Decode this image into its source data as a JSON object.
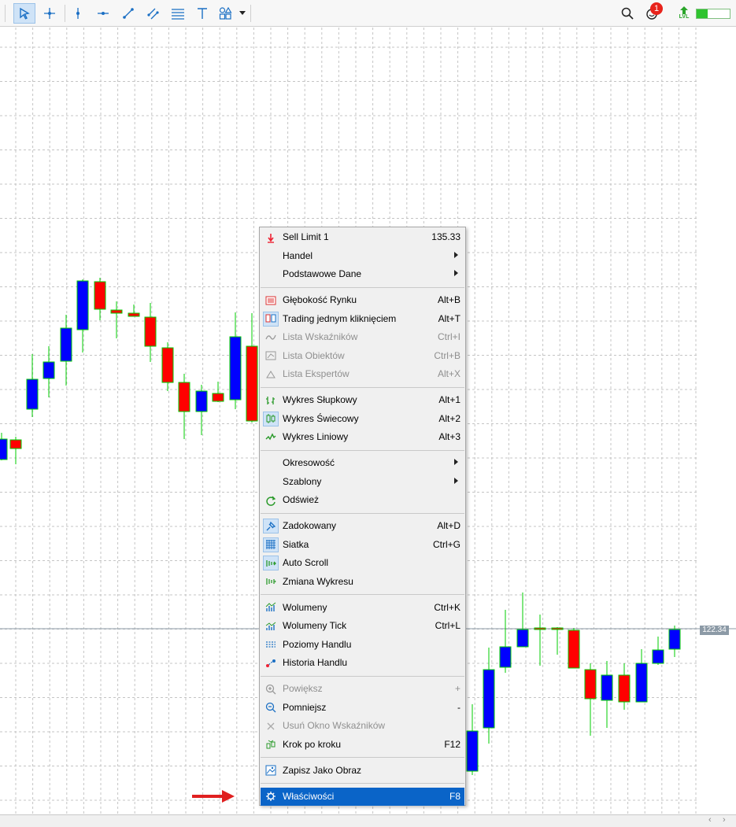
{
  "toolbar": {
    "tools": [
      "cursor-icon",
      "crosshair-icon",
      "vertical-line-icon",
      "horizontal-line-icon",
      "trendline-icon",
      "equidistant-channel-icon",
      "fibonacci-icon",
      "text-icon",
      "shapes-icon",
      "dropdown-arrow-icon"
    ],
    "right_icons": [
      "search-icon",
      "notifications-icon",
      "signal-lvl-icon",
      "battery-icon"
    ],
    "notification_count": "1",
    "lvl_label": "LVL"
  },
  "chart": {
    "current_price_label": "122.34",
    "bull_color": "#0000ff",
    "bear_color": "#ff0000",
    "wick_color": "#00cc00"
  },
  "context_menu": {
    "items": [
      {
        "label": "Sell Limit 1",
        "shortcut": "135.33",
        "icon": "sell-limit-icon"
      },
      {
        "label": "Handel",
        "submenu": true
      },
      {
        "label": "Podstawowe Dane",
        "submenu": true
      },
      {
        "label": "Głębokość Rynku",
        "shortcut": "Alt+B",
        "icon": "depth-of-market-icon"
      },
      {
        "label": "Trading jednym kliknięciem",
        "shortcut": "Alt+T",
        "icon": "one-click-trading-icon",
        "checked": true
      },
      {
        "label": "Lista Wskaźników",
        "shortcut": "Ctrl+I",
        "icon": "indicators-list-icon",
        "disabled": true
      },
      {
        "label": "Lista Obiektów",
        "shortcut": "Ctrl+B",
        "icon": "objects-list-icon",
        "disabled": true
      },
      {
        "label": "Lista Ekspertów",
        "shortcut": "Alt+X",
        "icon": "experts-list-icon",
        "disabled": true
      },
      {
        "label": "Wykres Słupkowy",
        "shortcut": "Alt+1",
        "icon": "bar-chart-icon"
      },
      {
        "label": "Wykres Świecowy",
        "shortcut": "Alt+2",
        "icon": "candlestick-chart-icon",
        "checked": true
      },
      {
        "label": "Wykres Liniowy",
        "shortcut": "Alt+3",
        "icon": "line-chart-icon"
      },
      {
        "label": "Okresowość",
        "submenu": true
      },
      {
        "label": "Szablony",
        "submenu": true
      },
      {
        "label": "Odśwież",
        "icon": "refresh-icon"
      },
      {
        "label": "Zadokowany",
        "shortcut": "Alt+D",
        "icon": "pin-icon",
        "checked": true
      },
      {
        "label": "Siatka",
        "shortcut": "Ctrl+G",
        "icon": "grid-icon",
        "checked": true
      },
      {
        "label": "Auto Scroll",
        "icon": "auto-scroll-icon",
        "checked": true
      },
      {
        "label": "Zmiana Wykresu",
        "icon": "chart-shift-icon"
      },
      {
        "label": "Wolumeny",
        "shortcut": "Ctrl+K",
        "icon": "volumes-icon"
      },
      {
        "label": "Wolumeny Tick",
        "shortcut": "Ctrl+L",
        "icon": "tick-volumes-icon"
      },
      {
        "label": "Poziomy Handlu",
        "icon": "trade-levels-icon"
      },
      {
        "label": "Historia Handlu",
        "icon": "trade-history-icon"
      },
      {
        "label": "Powiększ",
        "shortcut": "+",
        "icon": "zoom-in-icon",
        "disabled": true
      },
      {
        "label": "Pomniejsz",
        "shortcut": "-",
        "icon": "zoom-out-icon"
      },
      {
        "label": "Usuń Okno Wskaźników",
        "icon": "delete-window-icon",
        "disabled": true
      },
      {
        "label": "Krok po kroku",
        "shortcut": "F12",
        "icon": "step-icon"
      },
      {
        "label": "Zapisz Jako Obraz",
        "icon": "save-image-icon"
      },
      {
        "label": "Właściwości",
        "shortcut": "F8",
        "icon": "properties-icon",
        "selected": true
      }
    ]
  },
  "annotation": {
    "arrow_color": "#e02020"
  },
  "bottom_bar": {
    "scroll_left": "‹",
    "scroll_right": "›"
  }
}
